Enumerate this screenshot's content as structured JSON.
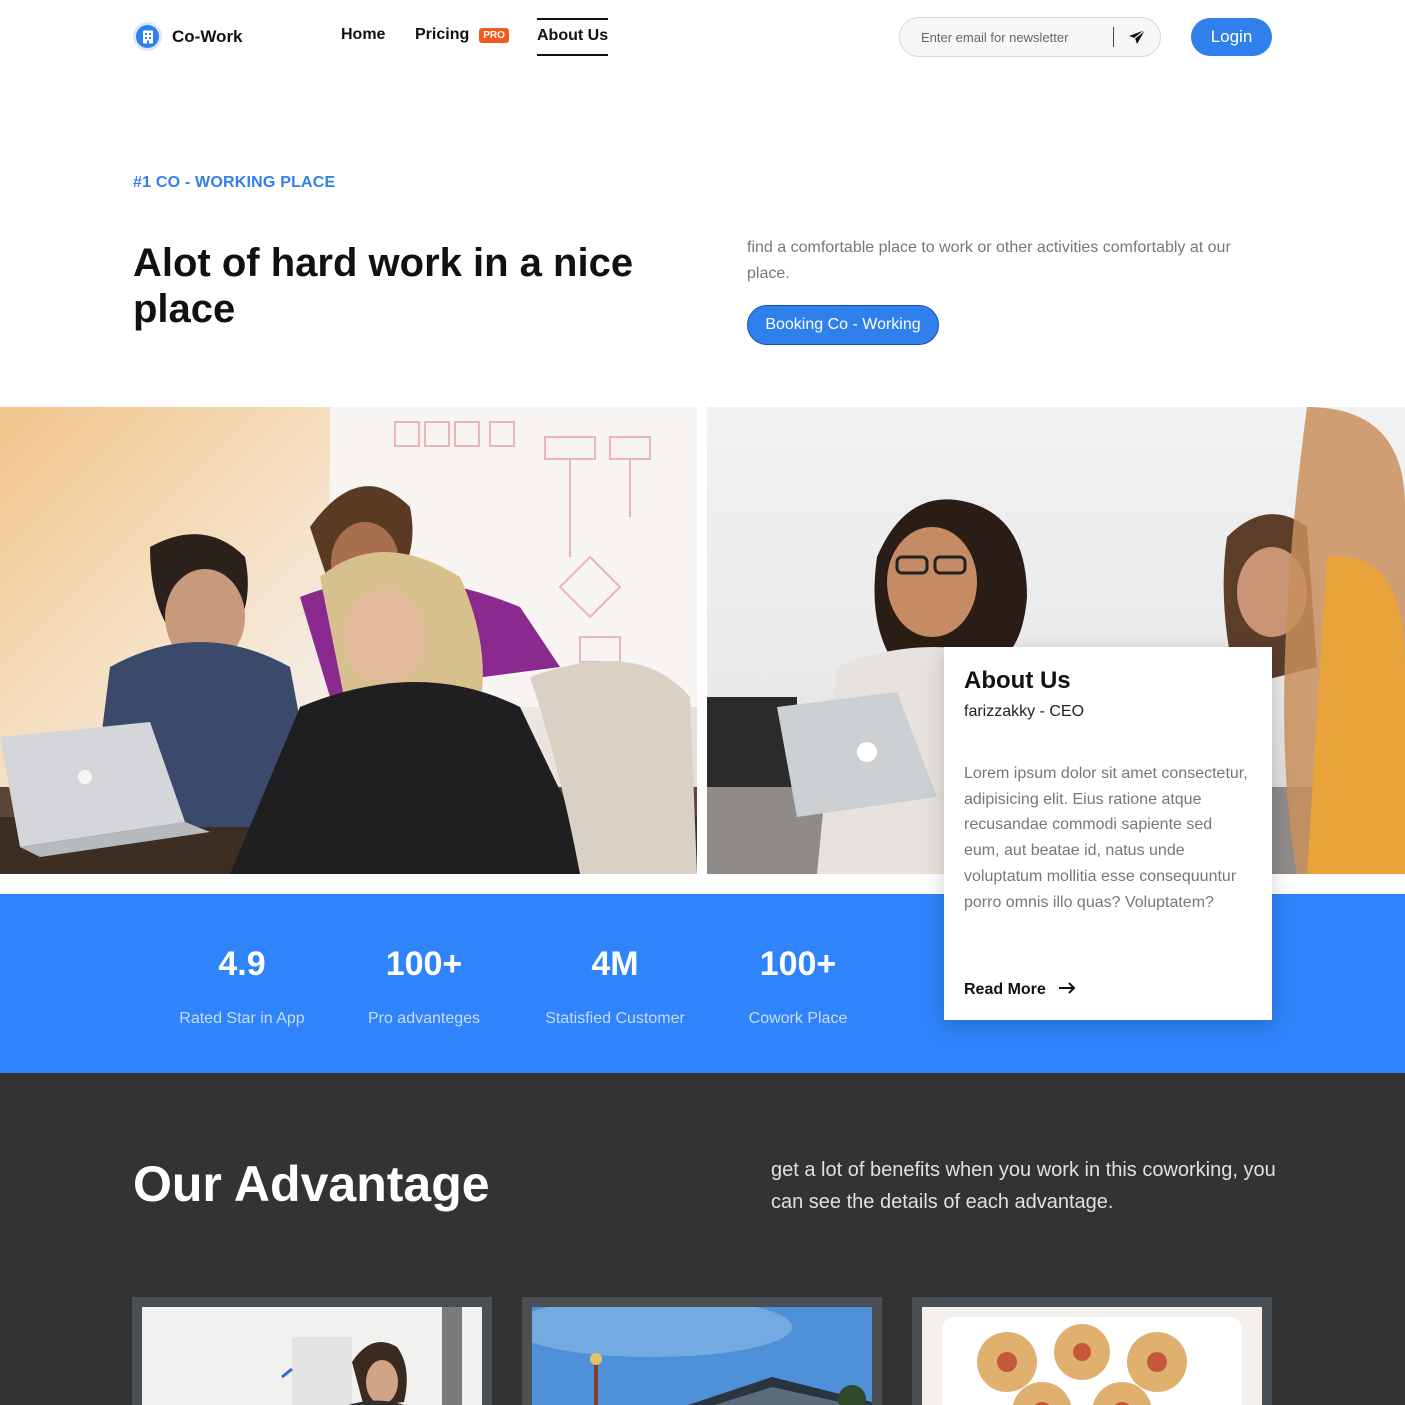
{
  "brand": {
    "name": "Co-Work",
    "color": "#2f80ed"
  },
  "nav": {
    "home": "Home",
    "pricing": "Pricing",
    "pricing_badge": "PRO",
    "about": "About Us",
    "active": "About Us"
  },
  "newsletter": {
    "placeholder": "Enter email for newsletter",
    "send_icon": "paper-plane-icon"
  },
  "login": "Login",
  "hero": {
    "eyebrow": "#1 CO - WORKING PLACE",
    "title": "Alot of hard work in a nice place",
    "description": "find a comfortable place to work or other activities comfortably at our place.",
    "cta": "Booking Co - Working"
  },
  "about_card": {
    "title": "About Us",
    "subtitle": "farizzakky - CEO",
    "body": "Lorem ipsum dolor sit amet consectetur, adipisicing elit. Eius ratione atque recusandae commodi sapiente sed eum, aut beatae id, natus unde voluptatum mollitia esse consequuntur porro omnis illo quas? Voluptatem?",
    "link": "Read More"
  },
  "stats": [
    {
      "value": "4.9",
      "label": "Rated Star in App"
    },
    {
      "value": "100+",
      "label": "Pro advanteges"
    },
    {
      "value": "4M",
      "label": "Statisfied Customer"
    },
    {
      "value": "100+",
      "label": "Cowork Place"
    }
  ],
  "advantage": {
    "title": "Our Advantage",
    "description": "get a lot of benefits when you work in this coworking, you can see the details of each advantage."
  },
  "colors": {
    "accent": "#2f80ed",
    "stats_bg": "#2f84fb",
    "dark_bg": "#333333",
    "badge": "#f25a1d"
  }
}
